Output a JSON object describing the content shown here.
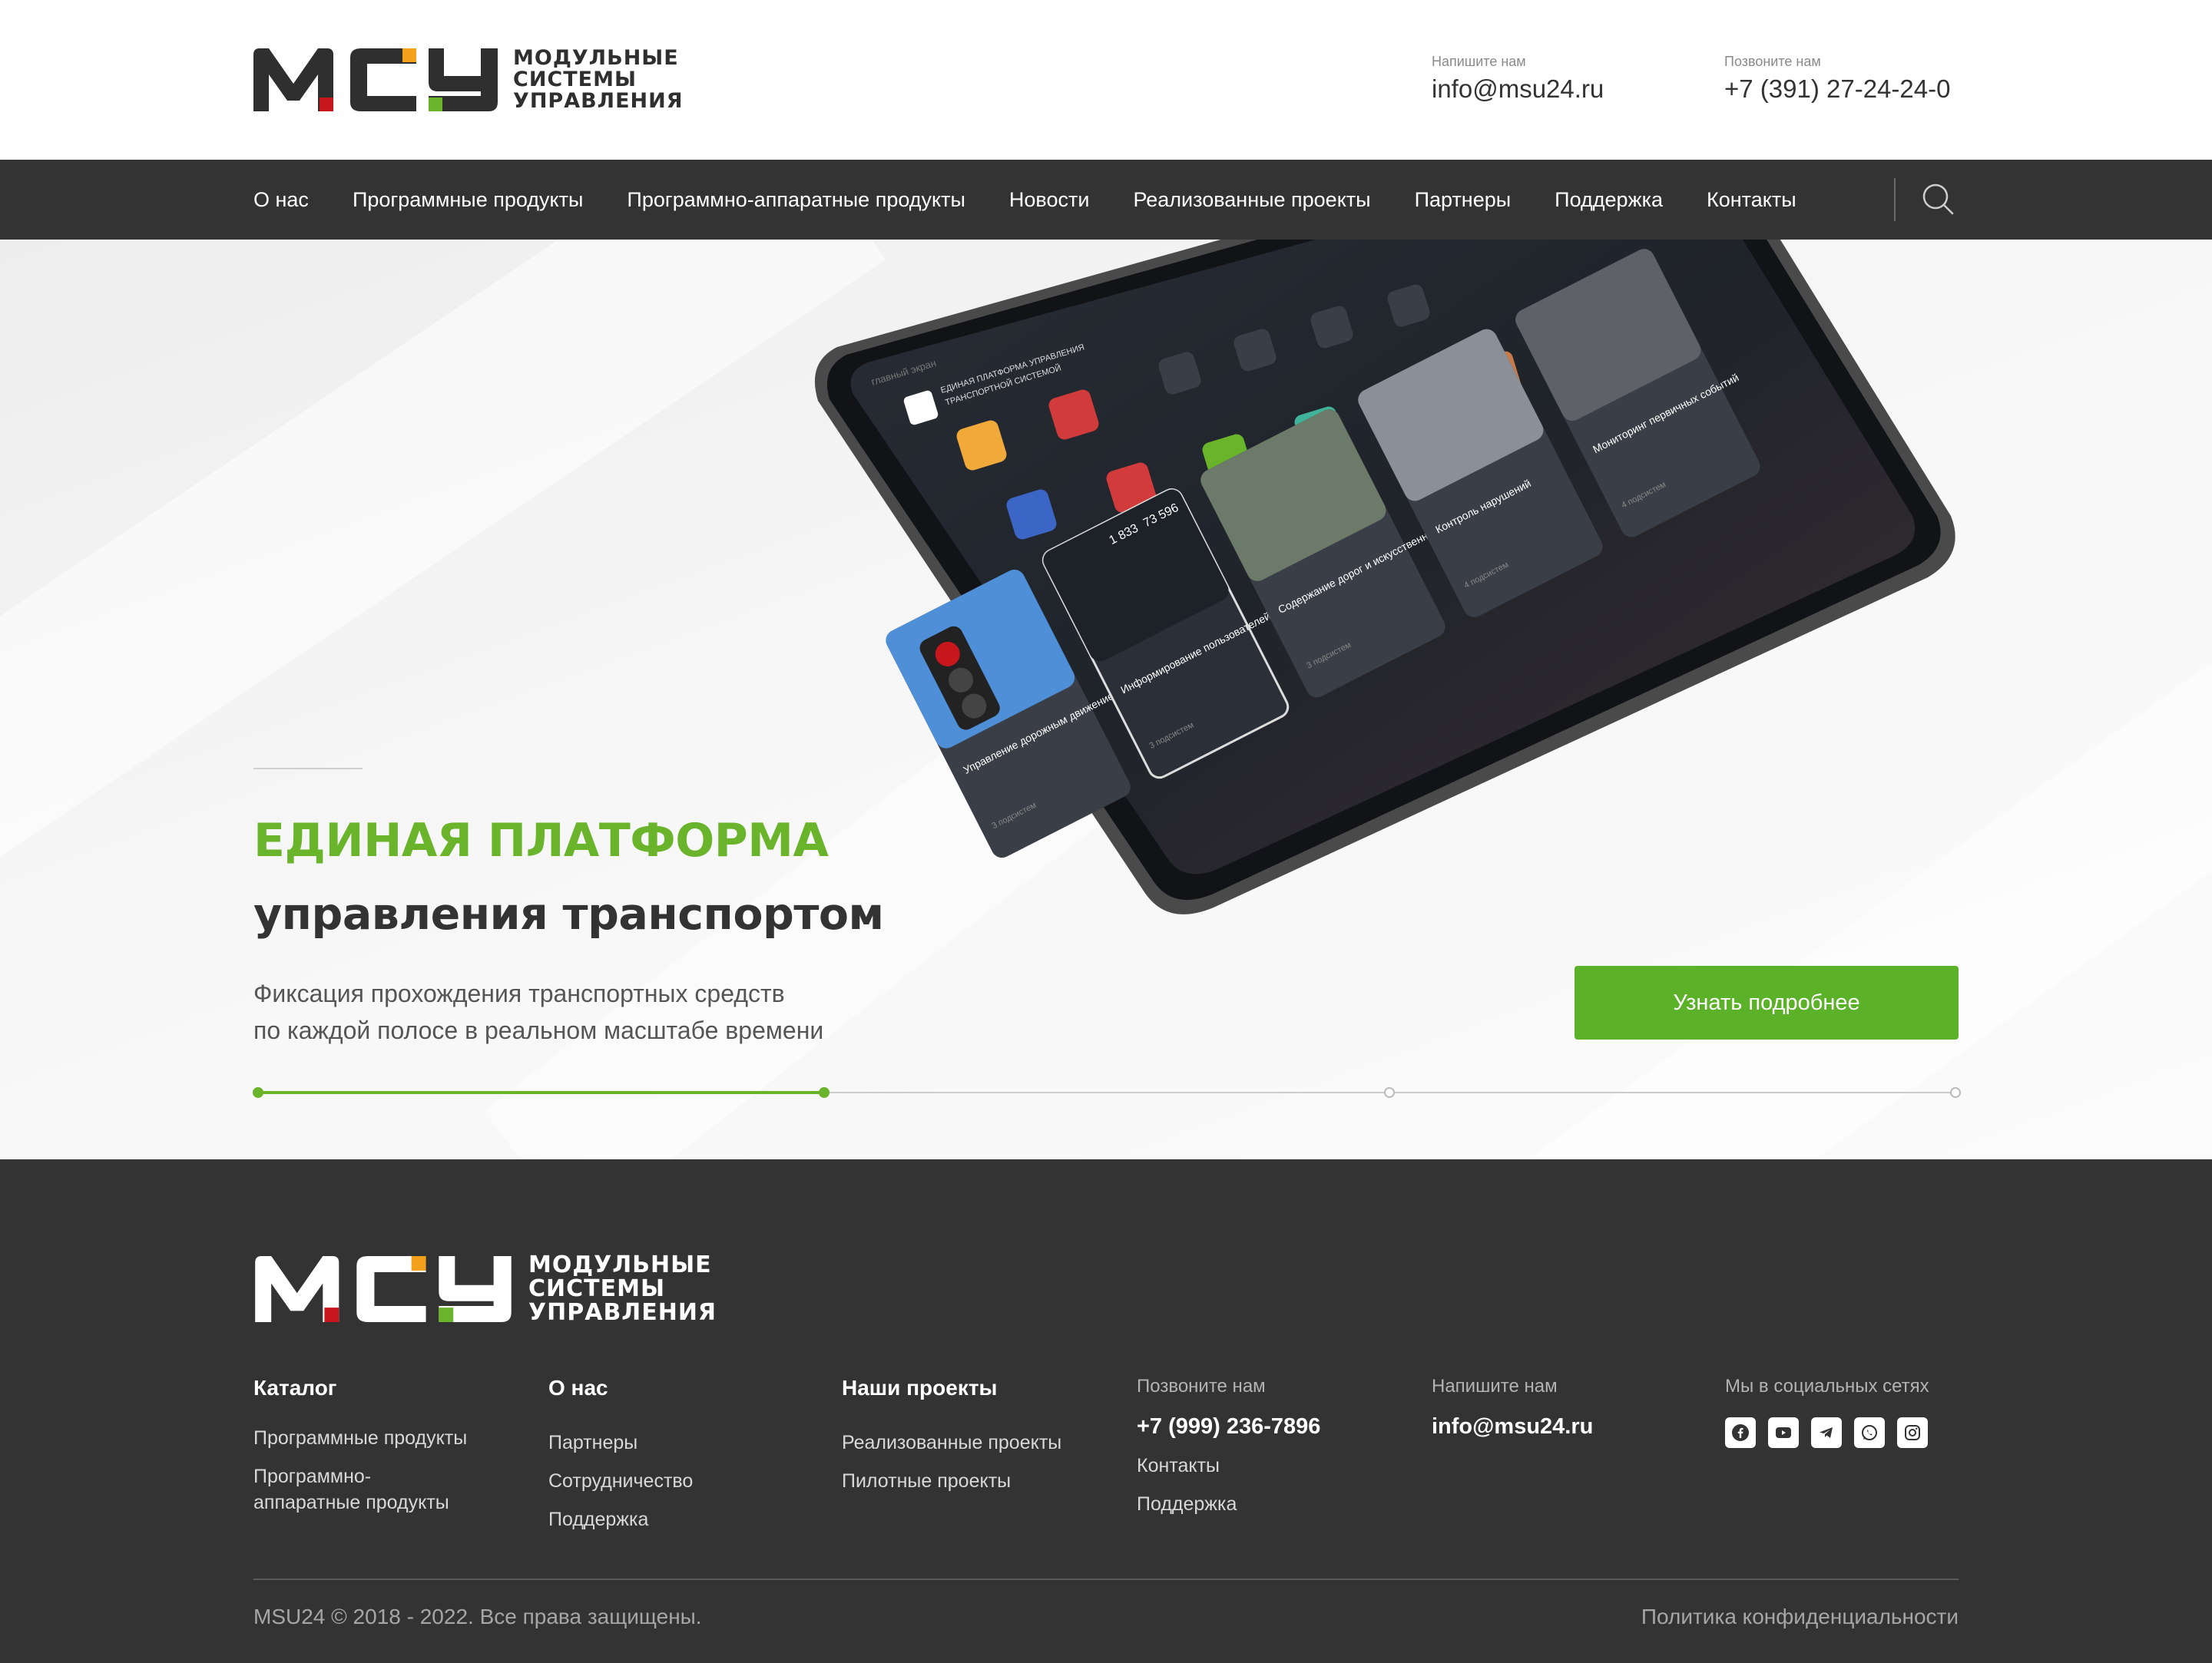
{
  "header": {
    "logo": {
      "letters": "МСУ",
      "line1": "МОДУЛЬНЫЕ",
      "line2": "СИСТЕМЫ",
      "line3": "УПРАВЛЕНИЯ"
    },
    "email_label": "Напишите нам",
    "email": "info@msu24.ru",
    "phone_label": "Позвоните нам",
    "phone": "+7 (391) 27-24-24-0"
  },
  "nav": {
    "items": [
      "О нас",
      "Программные продукты",
      "Программно-аппаратные продукты",
      "Новости",
      "Реализованные проекты",
      "Партнеры",
      "Поддержка",
      "Контакты"
    ],
    "search_icon": "search-icon"
  },
  "hero": {
    "title_green": "ЕДИНАЯ ПЛАТФОРМА",
    "title_dark": "управления транспортом",
    "subtitle_line1": "Фиксация прохождения транспортных средств",
    "subtitle_line2": "по каждой полосе в реальном масштабе времени",
    "button_label": "Узнать подробнее",
    "slider": {
      "total": 4,
      "active": 2
    },
    "tablet_screen": {
      "header_small": "главный экран",
      "header_title_line1": "ЕДИНАЯ ПЛАТФОРМА УПРАВЛЕНИЯ",
      "header_title_line2": "ТРАНСПОРТНОЙ СИСТЕМОЙ",
      "cards": [
        {
          "title": "Управление дорожным движением",
          "count": "3 подсистем"
        },
        {
          "title": "Информирование пользователей",
          "count": "3 подсистем"
        },
        {
          "title": "Содержание дорог и искусственных сооружений",
          "count": "3 подсистем"
        },
        {
          "title": "Контроль нарушений",
          "count": "4 подсистем"
        },
        {
          "title": "Мониторинг первичных событий",
          "count": "4 подсистем"
        }
      ],
      "stats": [
        "1 833",
        "73 596"
      ]
    },
    "colors": {
      "accent": "#6ab42c",
      "button": "#5bb127"
    }
  },
  "footer": {
    "logo": {
      "letters": "МСУ",
      "line1": "МОДУЛЬНЫЕ",
      "line2": "СИСТЕМЫ",
      "line3": "УПРАВЛЕНИЯ"
    },
    "catalog": {
      "title": "Каталог",
      "links": [
        "Программные продукты",
        "Программно-",
        "аппаратные продукты"
      ]
    },
    "about": {
      "title": "О нас",
      "links": [
        "Партнеры",
        "Сотрудничество",
        "Поддержка"
      ]
    },
    "projects": {
      "title": "Наши проекты",
      "links": [
        "Реализованные проекты",
        "Пилотные проекты"
      ]
    },
    "call": {
      "label": "Позвоните нам",
      "phone": "+7 (999) 236-7896",
      "links": [
        "Контакты",
        "Поддержка"
      ]
    },
    "write": {
      "label": "Напишите нам",
      "email": "info@msu24.ru"
    },
    "social": {
      "label": "Мы в социальных сетях",
      "icons": [
        "facebook-icon",
        "youtube-icon",
        "telegram-icon",
        "whatsapp-icon",
        "instagram-icon"
      ]
    },
    "copyright": "MSU24 © 2018 - 2022. Все права защищены.",
    "policy": "Политика конфиденциальности"
  }
}
